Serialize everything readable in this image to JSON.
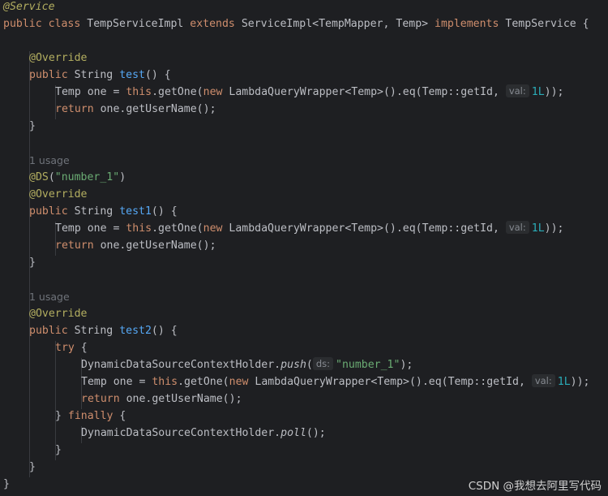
{
  "code": {
    "service_annotation": "@Service",
    "class_decl": {
      "kw_public": "public",
      "kw_class": "class",
      "class_name": "TempServiceImpl",
      "kw_extends": "extends",
      "super_class": "ServiceImpl<TempMapper, Temp>",
      "kw_implements": "implements",
      "interface_brace": "TempService {"
    },
    "override": "@Override",
    "kw_public": "public",
    "string_type": "String",
    "kw_new": "new",
    "kw_this": "this",
    "kw_return": "return",
    "brace_close": "}",
    "paren_brace": "() {",
    "temp_one": "Temp one = ",
    "getone_call": ".getOne(",
    "wrapper_call": "LambdaQueryWrapper<Temp>().eq(Temp::getId, ",
    "val_hint": "val:",
    "val_value": "1L",
    "close_parens": "));",
    "return_rest": "one.getUserName();",
    "usage_text": "1 usage",
    "ds_annotation": "@DS",
    "ds_value": "\"number_1\"",
    "ds_hint": "ds:",
    "method_test": "test",
    "method_test1": "test1",
    "method_test2": "test2",
    "kw_try": "try",
    "kw_finally": "finally",
    "try_brace": " {",
    "finally_prefix": "} ",
    "holder": "DynamicDataSourceContextHolder.",
    "push_method": "push",
    "poll_method": "poll",
    "poll_suffix": "();"
  },
  "watermark": "CSDN @我想去阿里写代码"
}
